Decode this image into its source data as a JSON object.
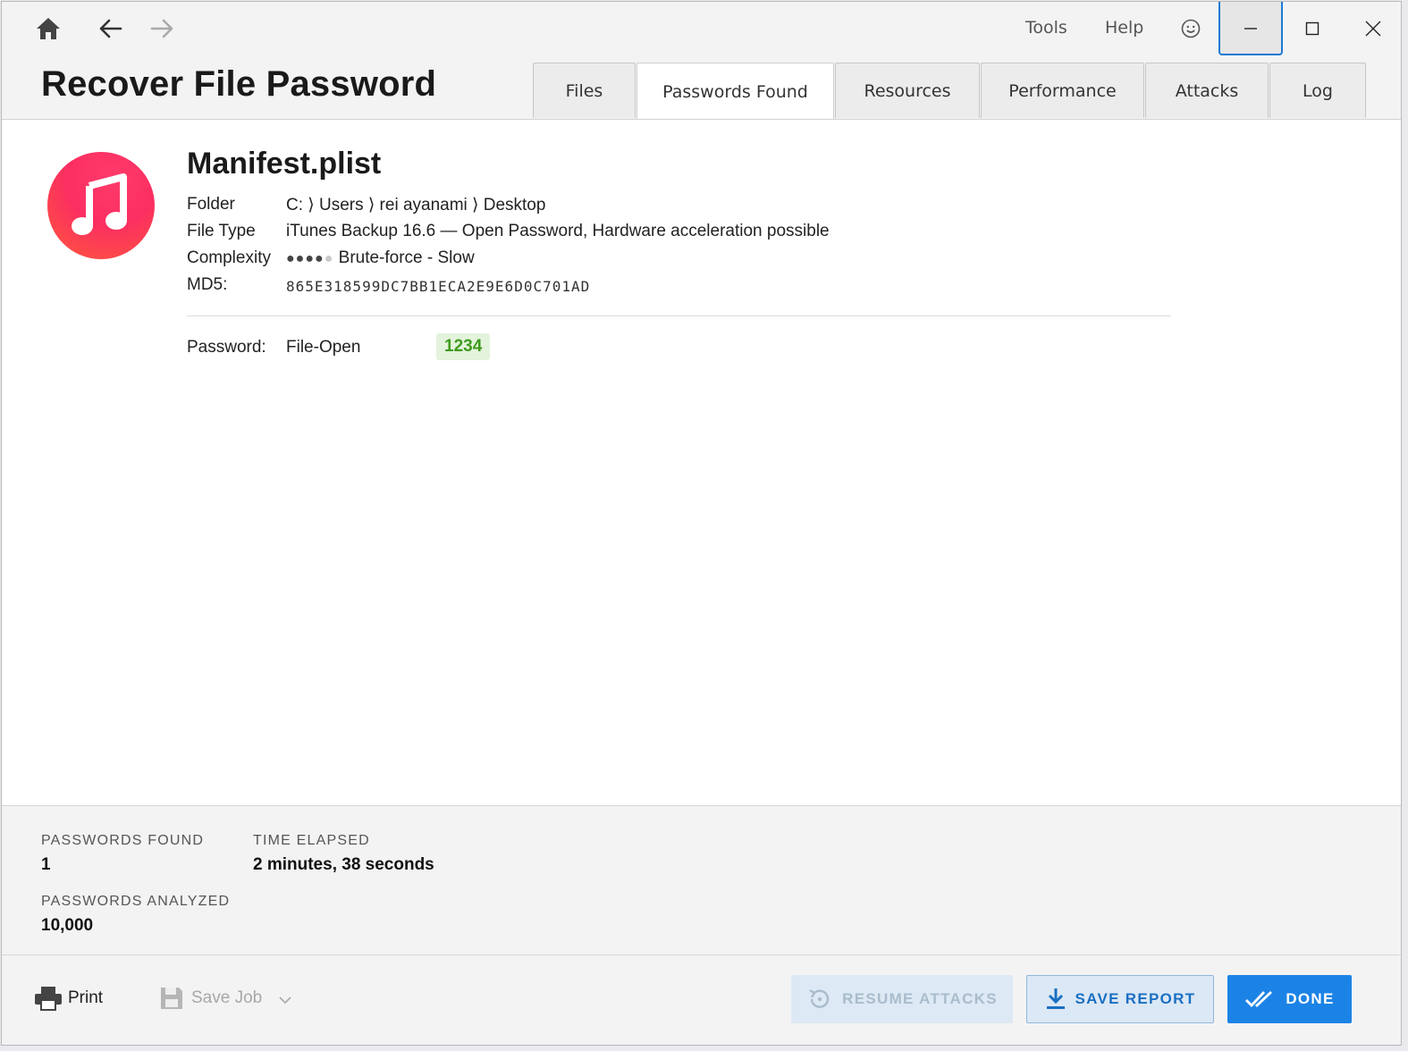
{
  "titlebar": {
    "home_icon": "home-icon",
    "back_icon": "arrow-left-icon",
    "forward_icon": "arrow-right-icon",
    "menu": [
      "Tools",
      "Help"
    ],
    "feedback_icon": "smiley-icon",
    "window_controls": [
      "minimize-icon",
      "maximize-icon",
      "close-icon"
    ]
  },
  "header": {
    "title": "Recover File Password",
    "tabs": [
      {
        "label": "Files",
        "active": false
      },
      {
        "label": "Passwords Found",
        "active": true
      },
      {
        "label": "Resources",
        "active": false
      },
      {
        "label": "Performance",
        "active": false
      },
      {
        "label": "Attacks",
        "active": false
      },
      {
        "label": "Log",
        "active": false
      }
    ]
  },
  "file": {
    "icon": "music-note-icon",
    "name": "Manifest.plist",
    "folder_label": "Folder",
    "folder_value": "C: ⟩ Users ⟩ rei ayanami ⟩ Desktop",
    "type_label": "File Type",
    "type_value": "iTunes Backup 16.6 — Open Password, Hardware acceleration possible",
    "complexity_label": "Complexity",
    "complexity_level": 4,
    "complexity_max": 5,
    "complexity_text": "Brute-force - Slow",
    "md5_label": "MD5:",
    "md5_value": "865E318599DC7BB1ECA2E9E6D0C701AD",
    "password_label": "Password:",
    "password_type": "File-Open",
    "password_value": "1234"
  },
  "stats": {
    "found_label": "PASSWORDS FOUND",
    "found_value": "1",
    "elapsed_label": "TIME ELAPSED",
    "elapsed_value": "2 minutes, 38 seconds",
    "analyzed_label": "PASSWORDS ANALYZED",
    "analyzed_value": "10,000"
  },
  "footer": {
    "print_label": "Print",
    "save_job_label": "Save Job",
    "resume_label": "RESUME ATTACKS",
    "save_report_label": "SAVE REPORT",
    "done_label": "DONE"
  },
  "colors": {
    "accent": "#1c83e6",
    "password_badge_bg": "#e3f3dc",
    "password_badge_text": "#3f9a1e",
    "icon_gradient_start": "#fb2f61",
    "icon_gradient_end": "#ff5a3a"
  }
}
